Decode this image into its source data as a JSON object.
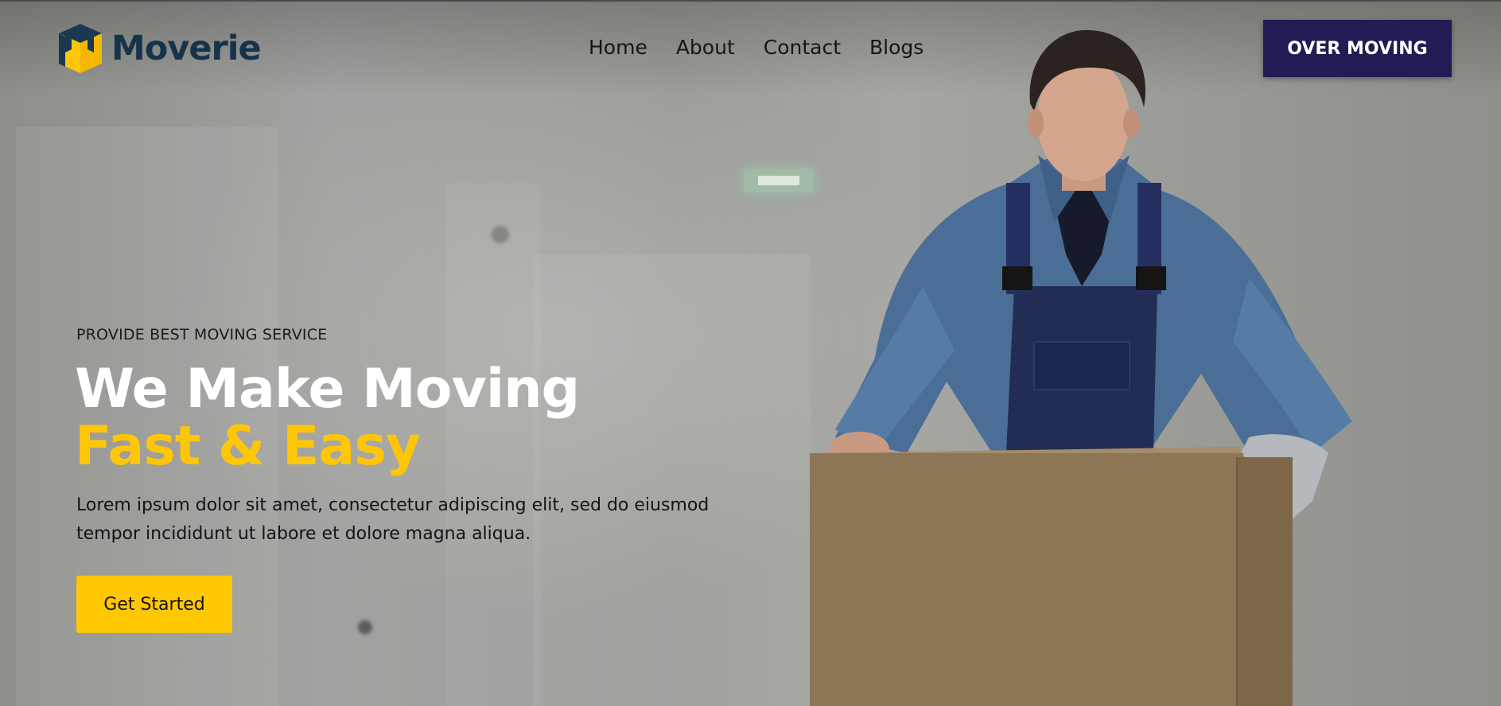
{
  "brand": {
    "name": "Moverie",
    "logo_icon": "box-logo-icon"
  },
  "nav": {
    "items": [
      {
        "label": "Home"
      },
      {
        "label": "About"
      },
      {
        "label": "Contact"
      },
      {
        "label": "Blogs"
      }
    ]
  },
  "header_cta": {
    "label": "OVER MOVING"
  },
  "hero": {
    "eyebrow": "PROVIDE BEST MOVING SERVICE",
    "headline_line1": "We Make Moving",
    "headline_line2": "Fast & Easy",
    "description": "Lorem ipsum dolor sit amet, consectetur adipiscing elit, sed do eiusmod tempor incididunt ut labore et dolore magna aliqua.",
    "cta_label": "Get Started"
  },
  "colors": {
    "accent_yellow": "#FEC701",
    "navy": "#221C55",
    "logo_text": "#17334B",
    "headline_white": "#FFFFFF"
  }
}
